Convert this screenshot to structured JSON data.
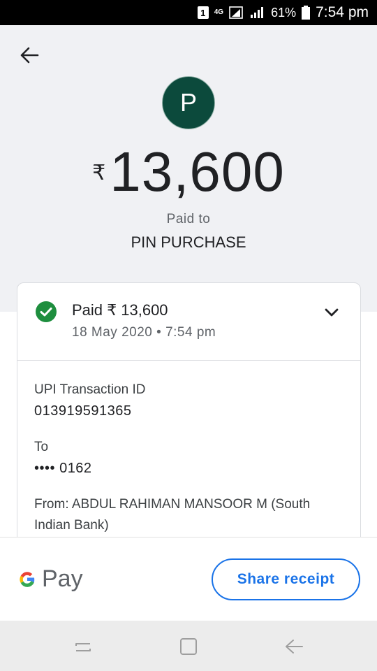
{
  "status_bar": {
    "badge": "1",
    "network": "4G",
    "battery": "61%",
    "time": "7:54 pm"
  },
  "header": {
    "back_icon": "arrow-left-icon",
    "avatar_letter": "P",
    "currency_symbol": "₹",
    "amount": "13,600",
    "paid_to_label": "Paid to",
    "payee_name": "PIN PURCHASE"
  },
  "card": {
    "status_icon": "check-circle-icon",
    "paid_line": "Paid ₹ 13,600",
    "date_time": "18 May 2020 • 7:54 pm",
    "expand_icon": "chevron-down-icon",
    "upi_label": "UPI Transaction ID",
    "upi_value": "013919591365",
    "to_label": "To",
    "to_value": "•••• 0162",
    "from_line1": "From: ABDUL RAHIMAN MANSOOR M (South",
    "from_line2": "Indian Bank)"
  },
  "footer": {
    "brand_text": "Pay",
    "brand_icon": "google-g-icon",
    "share_label": "Share receipt"
  },
  "nav": {
    "recents_icon": "recent-apps-icon",
    "home_icon": "home-square-icon",
    "back_icon": "nav-back-icon"
  },
  "colors": {
    "avatar_bg": "#0c4a3c",
    "success_green": "#1e8e3e",
    "accent_blue": "#1a73e8",
    "header_bg": "#f0f1f4"
  }
}
